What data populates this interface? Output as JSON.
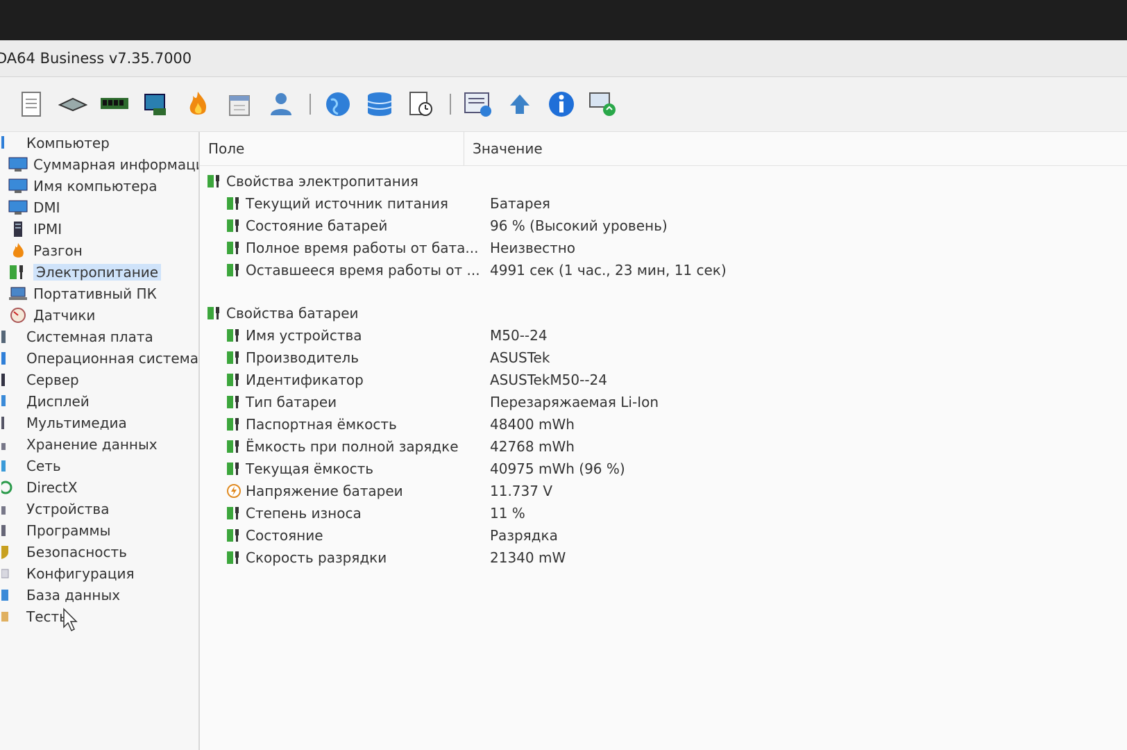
{
  "window": {
    "title": "DA64 Business v7.35.7000"
  },
  "toolbar": {
    "buttons": [
      "report-icon",
      "motherboard-icon",
      "memory-icon",
      "cpu-icon",
      "overclock-icon",
      "schedule-icon",
      "user-icon",
      "globe-icon",
      "database-icon",
      "log-icon",
      "network-report-icon",
      "update-icon",
      "info-icon",
      "remote-icon"
    ]
  },
  "sidebar": {
    "items": [
      {
        "label": "Компьютер",
        "level": "top",
        "icon": "computer-icon"
      },
      {
        "label": "Суммарная информация",
        "level": "child",
        "icon": "monitor-icon"
      },
      {
        "label": "Имя компьютера",
        "level": "child",
        "icon": "monitor-icon"
      },
      {
        "label": "DMI",
        "level": "child",
        "icon": "monitor-icon"
      },
      {
        "label": "IPMI",
        "level": "child",
        "icon": "server-icon"
      },
      {
        "label": "Разгон",
        "level": "child",
        "icon": "flame-icon"
      },
      {
        "label": "Электропитание",
        "level": "child",
        "icon": "battery-icon",
        "selected": true
      },
      {
        "label": "Портативный ПК",
        "level": "child",
        "icon": "laptop-icon"
      },
      {
        "label": "Датчики",
        "level": "child",
        "icon": "gauge-icon"
      },
      {
        "label": "Системная плата",
        "level": "top",
        "icon": "board-icon"
      },
      {
        "label": "Операционная система",
        "level": "top",
        "icon": "os-icon"
      },
      {
        "label": "Сервер",
        "level": "top",
        "icon": "server-icon"
      },
      {
        "label": "Дисплей",
        "level": "top",
        "icon": "display-icon"
      },
      {
        "label": "Мультимедиа",
        "level": "top",
        "icon": "multimedia-icon"
      },
      {
        "label": "Хранение данных",
        "level": "top",
        "icon": "storage-icon"
      },
      {
        "label": "Сеть",
        "level": "top",
        "icon": "network-icon"
      },
      {
        "label": "DirectX",
        "level": "top",
        "icon": "directx-icon"
      },
      {
        "label": "Устройства",
        "level": "top",
        "icon": "devices-icon"
      },
      {
        "label": "Программы",
        "level": "top",
        "icon": "programs-icon"
      },
      {
        "label": "Безопасность",
        "level": "top",
        "icon": "shield-icon"
      },
      {
        "label": "Конфигурация",
        "level": "top",
        "icon": "config-icon"
      },
      {
        "label": "База данных",
        "level": "top",
        "icon": "database-icon"
      },
      {
        "label": "Тесты",
        "level": "top",
        "icon": "tests-icon"
      }
    ]
  },
  "content": {
    "col_field": "Поле",
    "col_value": "Значение",
    "power_group": {
      "title": "Свойства электропитания",
      "rows": [
        {
          "field": "Текущий источник питания",
          "value": "Батарея"
        },
        {
          "field": "Состояние батарей",
          "value": "96 % (Высокий уровень)"
        },
        {
          "field": "Полное время работы от бата...",
          "value": "Неизвестно"
        },
        {
          "field": "Оставшееся время работы от ...",
          "value": "4991 сек (1 час., 23 мин, 11 сек)"
        }
      ]
    },
    "battery_group": {
      "title": "Свойства батареи",
      "rows": [
        {
          "field": "Имя устройства",
          "value": "M50--24",
          "icon": "plug-icon"
        },
        {
          "field": "Производитель",
          "value": "ASUSTek",
          "icon": "plug-icon"
        },
        {
          "field": "Идентификатор",
          "value": "ASUSTekM50--24",
          "icon": "plug-icon"
        },
        {
          "field": "Тип батареи",
          "value": "Перезаряжаемая Li-Ion",
          "icon": "plug-icon"
        },
        {
          "field": "Паспортная ёмкость",
          "value": "48400 mWh",
          "icon": "plug-icon"
        },
        {
          "field": "Ёмкость при полной зарядке",
          "value": "42768 mWh",
          "icon": "plug-icon"
        },
        {
          "field": "Текущая ёмкость",
          "value": "40975 mWh  (96 %)",
          "icon": "plug-icon"
        },
        {
          "field": "Напряжение батареи",
          "value": "11.737 V",
          "icon": "voltage-icon"
        },
        {
          "field": "Степень износа",
          "value": "11 %",
          "icon": "plug-icon"
        },
        {
          "field": "Состояние",
          "value": "Разрядка",
          "icon": "plug-icon"
        },
        {
          "field": "Скорость разрядки",
          "value": "21340 mW",
          "icon": "plug-icon"
        }
      ]
    }
  }
}
